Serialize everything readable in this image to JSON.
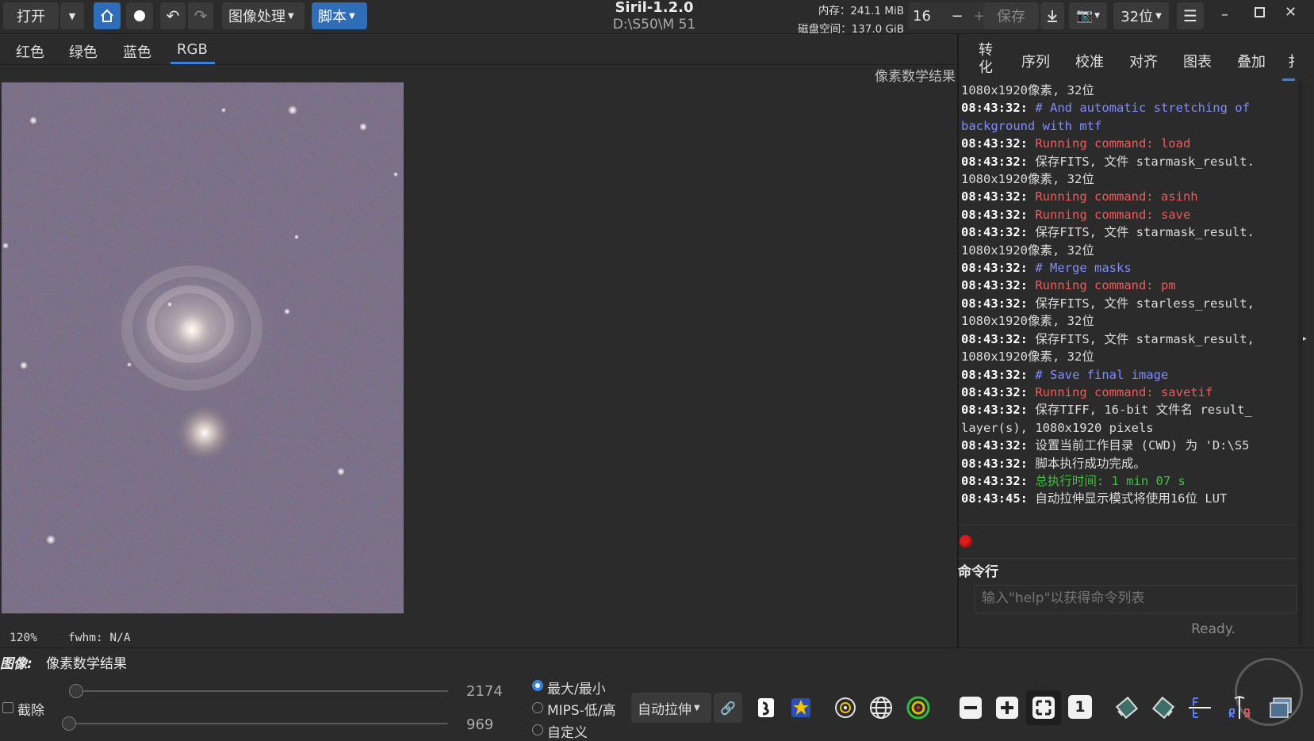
{
  "toolbar": {
    "open_label": "打开",
    "image_processing_label": "图像处理",
    "scripts_label": "脚本",
    "save_label": "保存",
    "bitdepth_label": "32位"
  },
  "title": {
    "app": "Siril-1.2.0",
    "path": "D:\\S50\\M 51"
  },
  "status": {
    "memory": "内存：241.1 MiB",
    "disk": "磁盘空间：137.0 GiB",
    "threads": "16"
  },
  "channel_tabs": [
    "红色",
    "绿色",
    "蓝色",
    "RGB"
  ],
  "active_channel_tab": "RGB",
  "image_name_overlay": "像素数学结果",
  "right_tabs": [
    "转化",
    "序列",
    "校准",
    "对齐",
    "图表",
    "叠加",
    "扌"
  ],
  "log": [
    {
      "text": "1080x1920像素, 32位",
      "color": "#dcdcdc"
    },
    {
      "ts": "08:43:32:",
      "text": " # And automatic stretching of",
      "color": "#7f8cff"
    },
    {
      "text": "background with mtf",
      "color": "#7f8cff"
    },
    {
      "ts": "08:43:32:",
      "text": " Running command: load",
      "color": "#f05a5a"
    },
    {
      "ts": "08:43:32:",
      "text": " 保存FITS, 文件 starmask_result.",
      "color": "#dcdcdc"
    },
    {
      "text": "1080x1920像素, 32位",
      "color": "#dcdcdc"
    },
    {
      "ts": "08:43:32:",
      "text": " Running command: asinh",
      "color": "#f05a5a"
    },
    {
      "ts": "08:43:32:",
      "text": " Running command: save",
      "color": "#f05a5a"
    },
    {
      "ts": "08:43:32:",
      "text": " 保存FITS, 文件 starmask_result.",
      "color": "#dcdcdc"
    },
    {
      "text": "1080x1920像素, 32位",
      "color": "#dcdcdc"
    },
    {
      "ts": "08:43:32:",
      "text": " # Merge masks",
      "color": "#7f8cff"
    },
    {
      "ts": "08:43:32:",
      "text": " Running command: pm",
      "color": "#f05a5a"
    },
    {
      "ts": "08:43:32:",
      "text": " 保存FITS, 文件 starless_result,",
      "color": "#dcdcdc"
    },
    {
      "text": "1080x1920像素, 32位",
      "color": "#dcdcdc"
    },
    {
      "ts": "08:43:32:",
      "text": " 保存FITS, 文件 starmask_result,",
      "color": "#dcdcdc"
    },
    {
      "text": "1080x1920像素, 32位",
      "color": "#dcdcdc"
    },
    {
      "ts": "08:43:32:",
      "text": " # Save final image",
      "color": "#7f8cff"
    },
    {
      "ts": "08:43:32:",
      "text": " Running command: savetif",
      "color": "#f05a5a"
    },
    {
      "ts": "08:43:32:",
      "text": " 保存TIFF, 16-bit 文件名 result_",
      "color": "#dcdcdc"
    },
    {
      "text": "layer(s), 1080x1920 pixels",
      "color": "#dcdcdc"
    },
    {
      "ts": "08:43:32:",
      "text": " 设置当前工作目录 (CWD) 为 'D:\\S5",
      "color": "#dcdcdc"
    },
    {
      "ts": "08:43:32:",
      "text": " 脚本执行成功完成。",
      "color": "#dcdcdc"
    },
    {
      "ts": "08:43:32:",
      "text": " 总执行时间: 1 min 07 s",
      "color": "#3cc23c"
    },
    {
      "ts": "08:43:45:",
      "text": " 自动拉伸显示模式将使用16位 LUT",
      "color": "#dcdcdc"
    }
  ],
  "command_line": {
    "label": "命令行",
    "placeholder": "输入\"help\"以获得命令列表",
    "status": "Ready."
  },
  "viewer": {
    "zoom": "120%",
    "fwhm": "fwhm: N/A",
    "image_label": "图像:",
    "image_name": "像素数学结果"
  },
  "bottom": {
    "clip_label": "截除",
    "high_value": "2174",
    "low_value": "969",
    "radio_minmax": "最大/最小",
    "radio_mips": "MIPS-低/高",
    "radio_custom": "自定义",
    "stretch_mode": "自动拉伸",
    "zoom_one_label": "1"
  },
  "colors": {
    "accent": "#2f6db9",
    "record_red": "#e01b1b"
  }
}
